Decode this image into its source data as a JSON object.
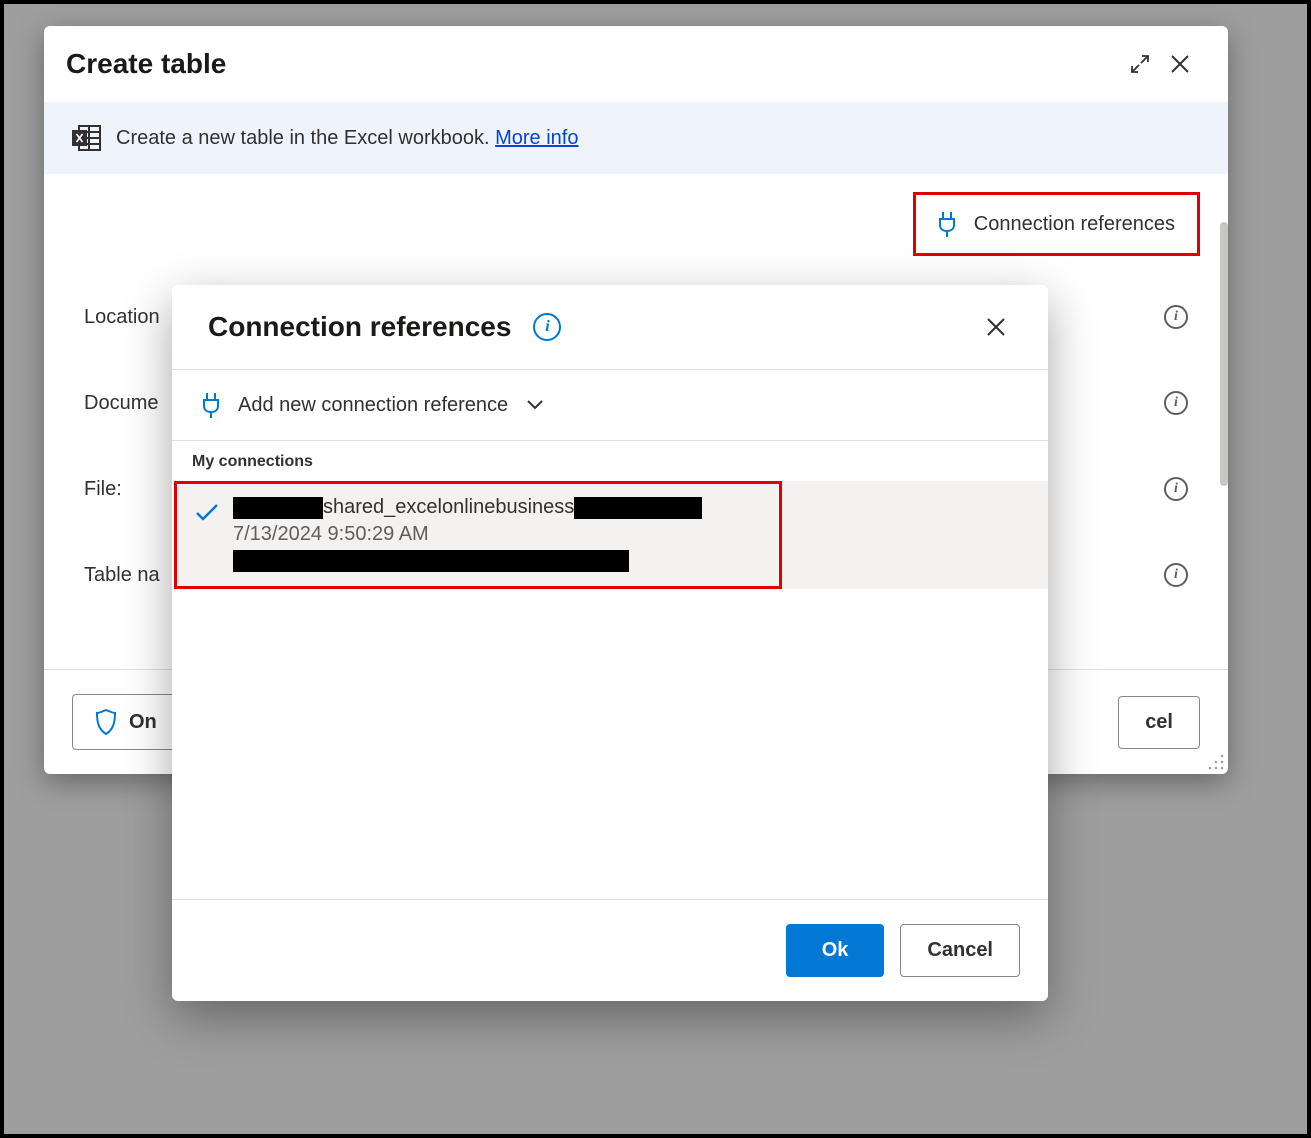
{
  "main": {
    "title": "Create table",
    "info_text": "Create a new table in the Excel workbook.",
    "more_info": "More info"
  },
  "connref_button_label": "Connection references",
  "form": {
    "location_label": "Location",
    "document_label": "Docume",
    "file_label": "File:",
    "table_label": "Table na"
  },
  "footer": {
    "shield_label": "On",
    "cancel_label": "cel"
  },
  "modal": {
    "title": "Connection references",
    "add_label": "Add new connection reference",
    "section_label": "My connections",
    "item": {
      "middle_text": "shared_excelonlinebusiness",
      "datetime": "7/13/2024 9:50:29 AM"
    },
    "ok_label": "Ok",
    "cancel_label": "Cancel"
  }
}
